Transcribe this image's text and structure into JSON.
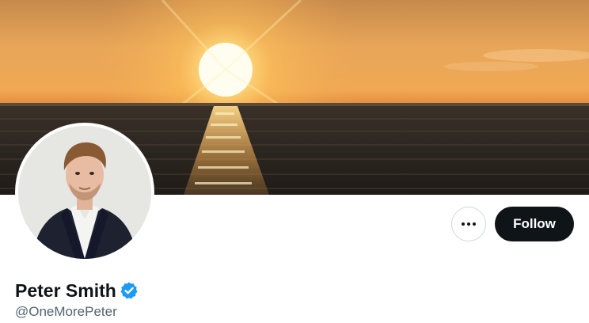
{
  "profile": {
    "display_name": "Peter Smith",
    "handle": "@OneMorePeter",
    "verified": true
  },
  "actions": {
    "more_label": "More",
    "follow_label": "Follow"
  },
  "icons": {
    "more": "more-horizontal-icon",
    "verified": "verified-badge-icon"
  },
  "colors": {
    "follow_button_bg": "#0f1419",
    "follow_button_text": "#ffffff",
    "handle_text": "#536471",
    "verified_badge": "#1d9bf0",
    "button_border": "#cfd9de"
  }
}
